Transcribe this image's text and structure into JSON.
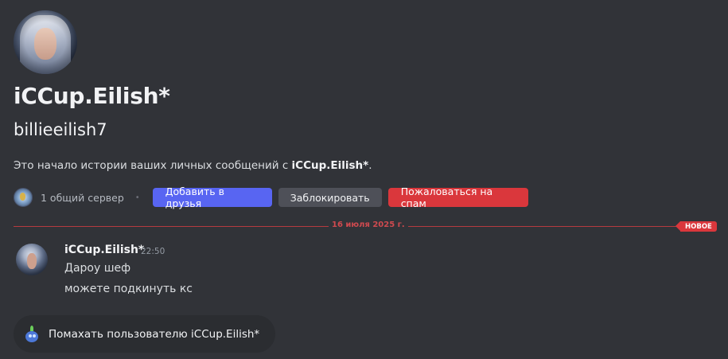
{
  "profile": {
    "display_name": "iCCup.Eilish*",
    "username": "billieeilish7",
    "intro_prefix": "Это начало истории ваших личных сообщений с ",
    "intro_name": "iCCup.Eilish*",
    "intro_suffix": "."
  },
  "actions": {
    "mutual_servers": "1 общий сервер",
    "separator": "•",
    "add_friend": "Добавить в друзья",
    "block": "Заблокировать",
    "report_spam": "Пожаловаться на спам"
  },
  "divider": {
    "date": "16 июля 2025 г.",
    "new_badge": "НОВОЕ"
  },
  "message": {
    "author": "iCCup.Eilish*",
    "time": "22:50",
    "lines": [
      "Дароу шеф",
      "можете подкинуть кс"
    ]
  },
  "wave": {
    "label": "Помахать пользователю iCCup.Eilish*"
  },
  "colors": {
    "background": "#313338",
    "primary_button": "#5865f2",
    "secondary_button": "#4e5058",
    "danger": "#da373c"
  },
  "icons": {
    "avatar": "user-avatar",
    "server": "server-icon",
    "wave": "wave-sticker-icon"
  }
}
